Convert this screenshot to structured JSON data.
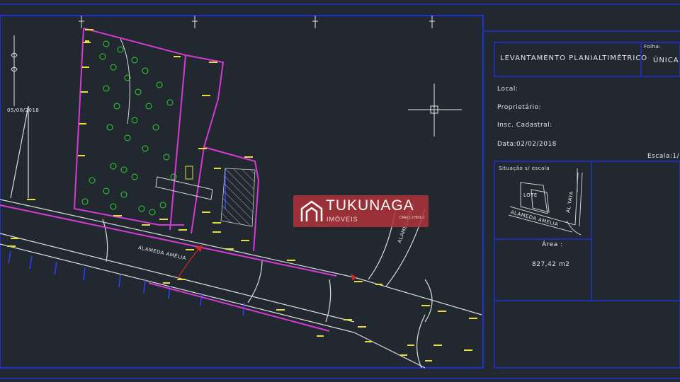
{
  "title_block": {
    "project_title": "LEVANTAMENTO PLANIALTIMÉTRICO",
    "sheet_label": "Folha:",
    "sheet_value": "ÚNICA",
    "local_label": "Local:",
    "owner_label": "Proprietário:",
    "cadastral_label": "Insc. Cadastral:",
    "date_text": "Data:02/02/2018",
    "scale_text": "Escala:1/",
    "location_label": "Situação s/ escala",
    "area_label": "Área :",
    "area_value": "827,42 m2",
    "mini_lote": "LOTE",
    "mini_street": "ALAMEDA AMELIA",
    "mini_avenue": "AL YAYA"
  },
  "drawing": {
    "street_main": "ALAMEDA AMÉLIA",
    "street_side": "ALAMEDA YAYA",
    "north_date": "05/08/2018"
  },
  "watermark": {
    "brand": "TUKUNAGA",
    "subtitle": "IMÓVEIS",
    "creci": "CRECI 27651-J"
  },
  "colors": {
    "background": "#212830",
    "frame_blue": "#1f2fd8",
    "lot_magenta": "#d63ad6",
    "tree_green": "#2fd62f",
    "label_yellow": "#e8e03a",
    "line_white": "#dcdcdc",
    "arrow_red": "#d02828",
    "watermark_red": "#af323a"
  }
}
